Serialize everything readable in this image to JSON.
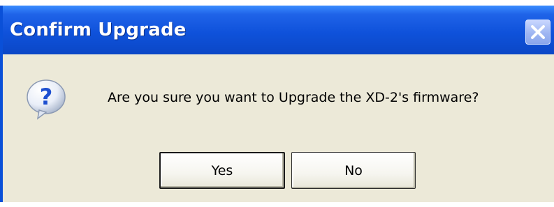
{
  "dialog": {
    "title": "Confirm Upgrade",
    "message": "Are you sure you want to Upgrade the XD-2's firmware?",
    "icon": "question-icon",
    "buttons": {
      "yes_label": "Yes",
      "no_label": "No"
    },
    "close_icon": "close-icon"
  },
  "colors": {
    "titlebar": "#0f52db",
    "body": "#ece9d8",
    "icon_blue": "#1d4fd0"
  }
}
